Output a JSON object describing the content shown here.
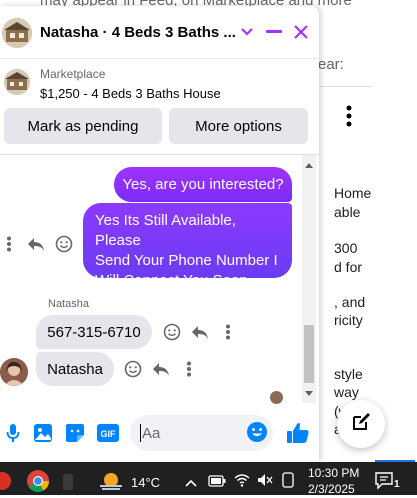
{
  "background_page": {
    "top_text": "may appear in Feed, on Marketplace and more",
    "year_text": "ear:",
    "lines": [
      "Home",
      "able",
      "300",
      "d for",
      ", and",
      "ricity",
      "style",
      "way",
      "(wit",
      "atin"
    ]
  },
  "chat": {
    "header_title": "Natasha · 4 Beds 3 Baths ...",
    "listing": {
      "source": "Marketplace",
      "name": "$1,250 - 4 Beds 3 Baths House"
    },
    "buttons": {
      "pending": "Mark as pending",
      "more": "More options"
    },
    "messages": {
      "out_1": "Yes, are you interested?",
      "out_2": [
        "Yes Its Still Available, Please",
        "Send Your Phone Number I",
        "Will Connect You Soon"
      ],
      "sender_name": "Natasha",
      "in_1": "567-315-6710",
      "in_2": "Natasha"
    },
    "composer": {
      "placeholder": "Aa",
      "gif_label": "GIF"
    }
  },
  "taskbar": {
    "temperature": "14°C",
    "time": "10:30 PM",
    "date": "2/3/2025",
    "notification_count": "1"
  },
  "colors": {
    "messenger_purple": "#8d39ff",
    "messenger_blue": "#0084ff",
    "close_purple": "#a033ff"
  }
}
